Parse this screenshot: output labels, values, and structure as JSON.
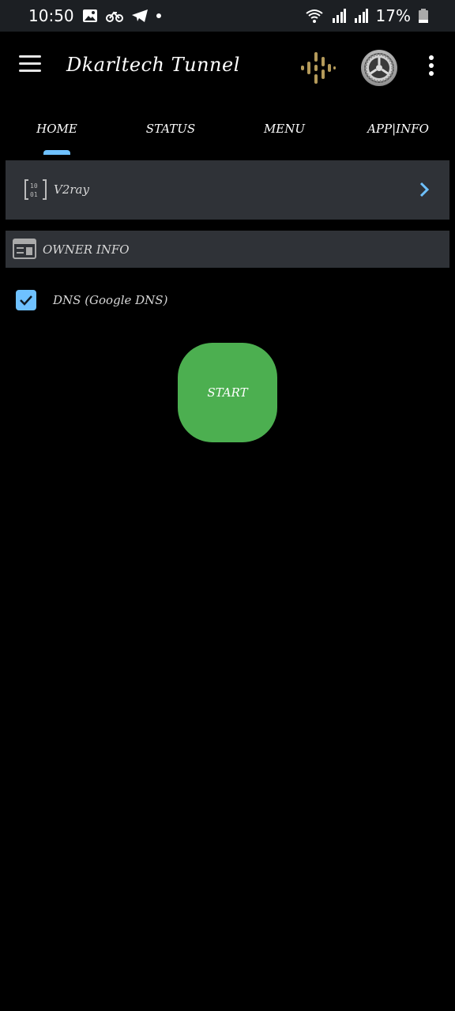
{
  "status_bar": {
    "time": "10:50",
    "battery": "17%",
    "left_icons": [
      "image-icon",
      "bike-icon",
      "telegram-icon",
      "notification-dot-icon"
    ],
    "right_icons": [
      "wifi-icon",
      "signal-icon",
      "signal-icon",
      "battery-icon"
    ]
  },
  "toolbar": {
    "title": "Dkarltech Tunnel",
    "icons": [
      "hamburger-menu-icon",
      "podcast-icon",
      "settings-gear-icon",
      "more-vert-icon"
    ],
    "podcast_icon_color": "#b49a5a"
  },
  "tabs": [
    {
      "label": "HOME",
      "selected": true
    },
    {
      "label": "STATUS",
      "selected": false
    },
    {
      "label": "MENU",
      "selected": false
    },
    {
      "label": "APP|INFO",
      "selected": false
    }
  ],
  "server": {
    "label": "V2ray",
    "icon": "binary-icon",
    "action_icon": "chevron-right-icon"
  },
  "owner_info": {
    "label": "OWNER INFO",
    "icon": "table-icon"
  },
  "dns": {
    "label": "DNS (Google DNS)",
    "checked": true
  },
  "start_button": {
    "label": "START"
  },
  "colors": {
    "accent": "#6ec1ff",
    "start": "#4caf50",
    "card": "#2f3237",
    "status_bar": "#1c1f23",
    "background": "#000000"
  }
}
